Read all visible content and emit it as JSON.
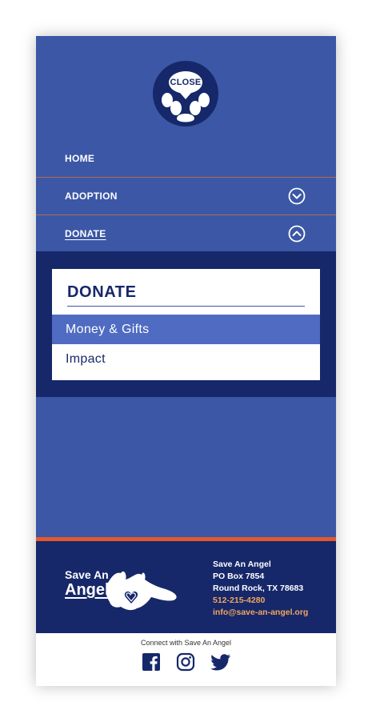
{
  "header": {
    "close_label": "CLOSE"
  },
  "nav": {
    "items": [
      {
        "label": "HOME"
      },
      {
        "label": "ADOPTION",
        "icon": "chevron-down-circle-icon"
      },
      {
        "label": "DONATE",
        "icon": "chevron-up-circle-icon"
      }
    ]
  },
  "submenu": {
    "title": "DONATE",
    "items": [
      {
        "label": "Money & Gifts"
      },
      {
        "label": "Impact"
      }
    ]
  },
  "footer": {
    "logo_line1": "Save An",
    "logo_line2": "Angel",
    "org_name": "Save An Angel",
    "po_box": "PO Box 7854",
    "city": "Round Rock, TX 78683",
    "phone": "512-215-4280",
    "email": "info@save-an-angel.org"
  },
  "social": {
    "connect_text": "Connect with Save An Angel",
    "icons": [
      "facebook-icon",
      "instagram-icon",
      "twitter-icon"
    ]
  },
  "colors": {
    "primary_blue": "#3b57a6",
    "navy": "#16286a",
    "selected_blue": "#4f6bc2",
    "accent_orange": "#e2582b",
    "link_orange": "#f2a65c"
  }
}
